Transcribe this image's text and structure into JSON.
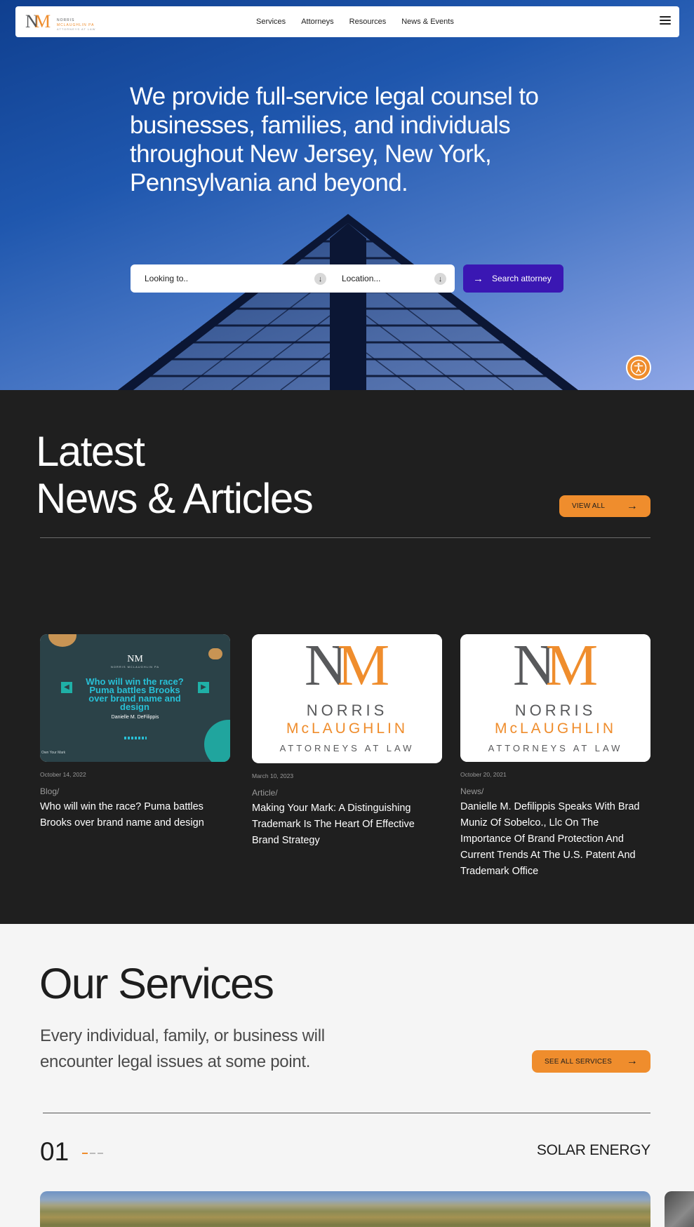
{
  "colors": {
    "accent": "#ef8d2d",
    "primary_button": "#3a17b3",
    "dark_bg": "#1f1f1f",
    "light_bg": "#f5f5f5",
    "logo_gray": "#58595b"
  },
  "header": {
    "logo": {
      "mark_n": "N",
      "mark_m": "M",
      "line1": "NORRIS",
      "line2": "MCLAUGHLIN PA",
      "line3": "ATTORNEYS AT LAW"
    },
    "nav": [
      "Services",
      "Attorneys",
      "Resources",
      "News & Events"
    ],
    "menu_icon": "hamburger-icon"
  },
  "hero": {
    "headline": "We provide full-service legal counsel to businesses, families, and individuals throughout New Jersey, New York, Pennsylvania and beyond.",
    "search": {
      "looking_placeholder": "Looking to..",
      "location_placeholder": "Location...",
      "button_label": "Search attorney"
    },
    "accessibility_icon": "accessibility-icon"
  },
  "news": {
    "title_line1": "Latest",
    "title_line2": "News & Articles",
    "view_all_label": "VIEW ALL",
    "cards": [
      {
        "date": "October 14, 2022",
        "category": "Blog/",
        "title": "Who will win the race? Puma battles Brooks over brand name and design",
        "image": {
          "logo": "NM",
          "logo_sub": "NORRIS MCLAUGHLIN PA",
          "headline": "Who will win the race? Puma battles Brooks over brand name and design",
          "byline": "Danielle M. DeFilippis",
          "corner": "Own Your Mark"
        }
      },
      {
        "date": "March 10, 2023",
        "category": "Article/",
        "title": "Making Your Mark: A Distinguishing Trademark Is The Heart Of Effective Brand Strategy",
        "image": {
          "mark_n": "N",
          "mark_m": "M",
          "line1": "NORRIS",
          "line2": "McLAUGHLIN",
          "line3": "ATTORNEYS AT LAW"
        }
      },
      {
        "date": "October 20, 2021",
        "category": "News/",
        "title": "Danielle M. Defilippis Speaks With Brad Muniz Of Sobelco., Llc On The Importance Of Brand Protection And Current Trends At The U.S. Patent And Trademark Office",
        "image": {
          "mark_n": "N",
          "mark_m": "M",
          "line1": "NORRIS",
          "line2": "McLAUGHLIN",
          "line3": "ATTORNEYS AT LAW"
        }
      }
    ]
  },
  "services": {
    "title": "Our Services",
    "subtitle": "Every individual, family, or business will encounter legal issues at some point.",
    "see_all_label": "SEE ALL SERVICES",
    "item": {
      "number": "01",
      "name": "SOLAR ENERGY"
    }
  }
}
